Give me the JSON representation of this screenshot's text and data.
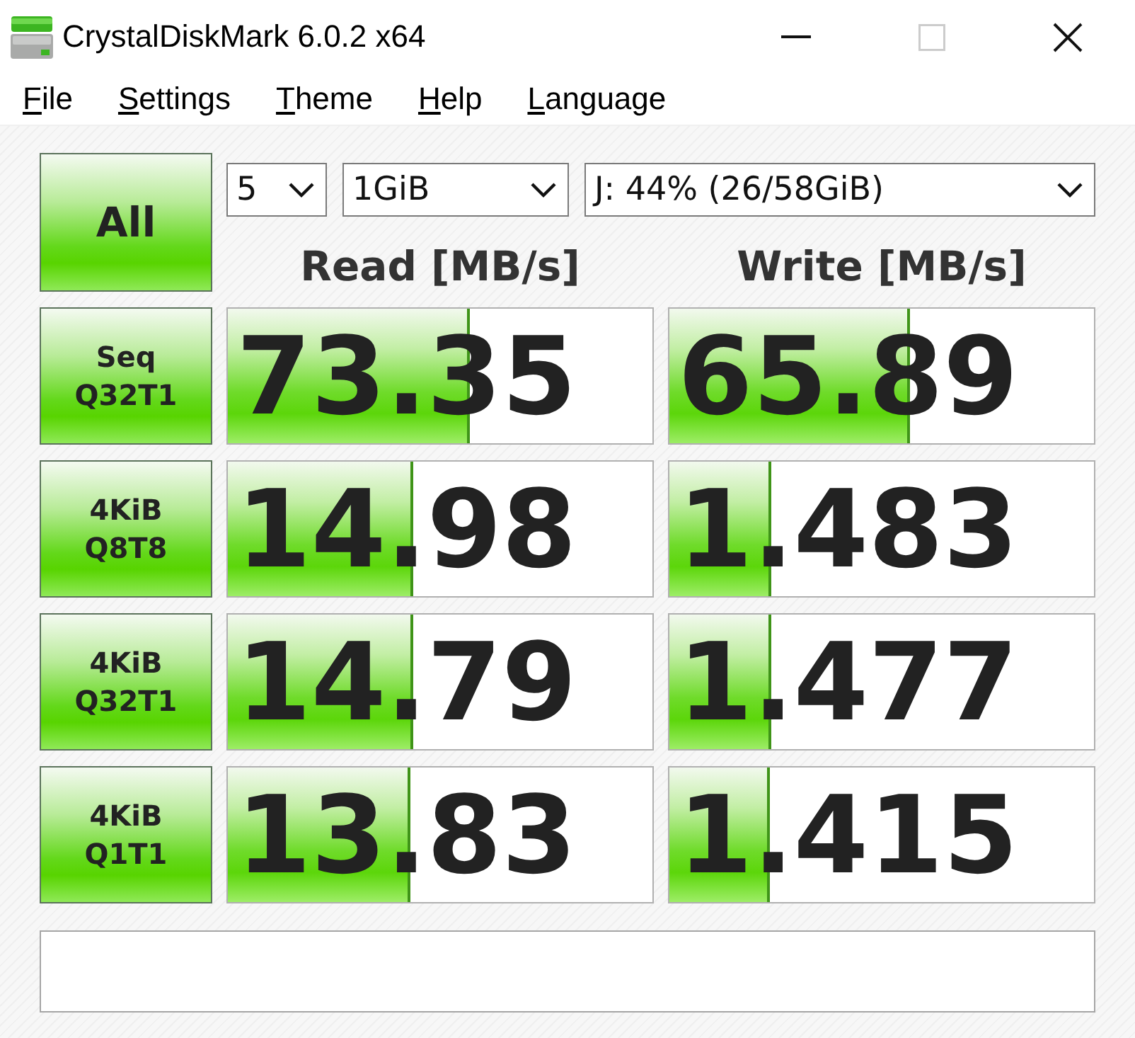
{
  "window": {
    "title": "CrystalDiskMark 6.0.2 x64",
    "maximize_disabled": true
  },
  "menu": [
    {
      "label": "File"
    },
    {
      "label": "Settings"
    },
    {
      "label": "Theme"
    },
    {
      "label": "Help"
    },
    {
      "label": "Language"
    }
  ],
  "controls": {
    "all_button": "All",
    "test_count": "5",
    "test_size": "1GiB",
    "drive": "J: 44% (26/58GiB)"
  },
  "columns": [
    "Read [MB/s]",
    "Write [MB/s]"
  ],
  "rows": [
    {
      "label": [
        "Seq",
        "Q32T1"
      ],
      "read": {
        "value": "73.35",
        "level": 0.57
      },
      "write": {
        "value": "65.89",
        "level": 0.566
      }
    },
    {
      "label": [
        "4KiB",
        "Q8T8"
      ],
      "read": {
        "value": "14.98",
        "level": 0.435
      },
      "write": {
        "value": "1.483",
        "level": 0.24
      }
    },
    {
      "label": [
        "4KiB",
        "Q32T1"
      ],
      "read": {
        "value": "14.79",
        "level": 0.436
      },
      "write": {
        "value": "1.477",
        "level": 0.241
      }
    },
    {
      "label": [
        "4KiB",
        "Q1T1"
      ],
      "read": {
        "value": "13.83",
        "level": 0.43
      },
      "write": {
        "value": "1.415",
        "level": 0.236
      }
    }
  ]
}
